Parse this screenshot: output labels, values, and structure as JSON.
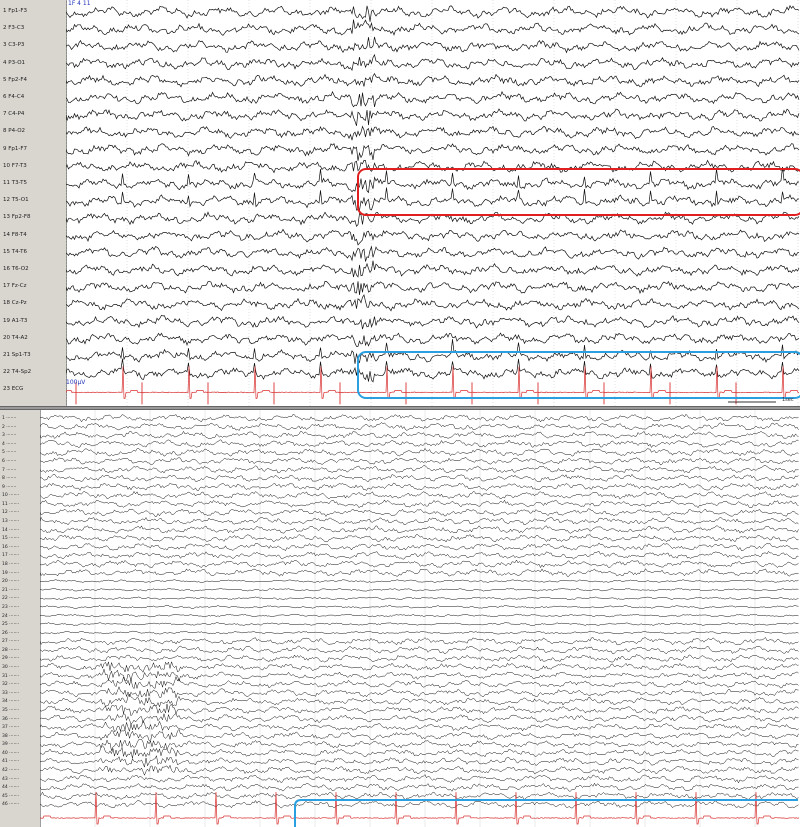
{
  "top_panel": {
    "corner_label": "1F 4 11",
    "sensitivity": "100µV",
    "scale_label": "1sec",
    "channels": [
      {
        "label": "1 Fp1-F3",
        "color": "#111111",
        "spiky": false
      },
      {
        "label": "2 F3-C3",
        "color": "#111111",
        "spiky": false
      },
      {
        "label": "3 C3-P3",
        "color": "#111111",
        "spiky": false
      },
      {
        "label": "4 P3-O1",
        "color": "#111111",
        "spiky": false
      },
      {
        "label": "5 Fp2-F4",
        "color": "#111111",
        "spiky": false
      },
      {
        "label": "6 F4-C4",
        "color": "#111111",
        "spiky": false
      },
      {
        "label": "7 C4-P4",
        "color": "#111111",
        "spiky": false
      },
      {
        "label": "8 P4-O2",
        "color": "#111111",
        "spiky": false
      },
      {
        "label": "9 Fp1-F7",
        "color": "#111111",
        "spiky": false
      },
      {
        "label": "10 F7-T3",
        "color": "#111111",
        "spiky": false
      },
      {
        "label": "11 T3-T5",
        "color": "#111111",
        "spiky": true
      },
      {
        "label": "12 T5-O1",
        "color": "#111111",
        "spiky": true
      },
      {
        "label": "13 Fp2-F8",
        "color": "#111111",
        "spiky": false
      },
      {
        "label": "14 F8-T4",
        "color": "#111111",
        "spiky": false
      },
      {
        "label": "15 T4-T6",
        "color": "#111111",
        "spiky": false
      },
      {
        "label": "16 T6-O2",
        "color": "#111111",
        "spiky": false
      },
      {
        "label": "17 Fz-Cz",
        "color": "#111111",
        "spiky": false
      },
      {
        "label": "18 Cz-Pz",
        "color": "#111111",
        "spiky": false
      },
      {
        "label": "19 A1-T3",
        "color": "#111111",
        "spiky": false
      },
      {
        "label": "20 T4-A2",
        "color": "#111111",
        "spiky": false
      },
      {
        "label": "21 Sp1-T3",
        "color": "#111111",
        "spiky": true
      },
      {
        "label": "22 T4-Sp2",
        "color": "#111111",
        "spiky": true
      },
      {
        "label": "23 ECG",
        "color": "#d93030",
        "spiky": false,
        "ecg": true
      }
    ],
    "highlights": [
      {
        "name": "red-highlight-box",
        "color": "#e02020"
      },
      {
        "name": "blue-highlight-box",
        "color": "#2aa0e0"
      }
    ]
  },
  "bottom_panel": {
    "channel_count": 46,
    "ecg_color": "#d93030",
    "highlight_color": "#2aa0e0"
  }
}
